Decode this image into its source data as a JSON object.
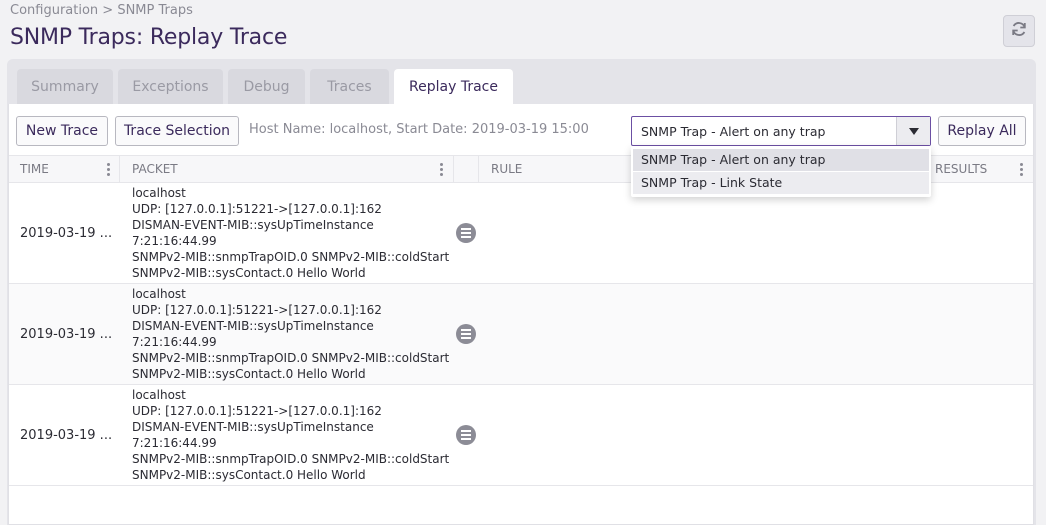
{
  "breadcrumb": "Configuration > SNMP Traps",
  "page_title": "SNMP Traps: Replay Trace",
  "refresh_icon": "refresh-icon",
  "tabs": [
    {
      "label": "Summary",
      "active": false
    },
    {
      "label": "Exceptions",
      "active": false
    },
    {
      "label": "Debug",
      "active": false
    },
    {
      "label": "Traces",
      "active": false
    },
    {
      "label": "Replay Trace",
      "active": true
    }
  ],
  "toolbar": {
    "new_trace": "New Trace",
    "trace_selection": "Trace Selection",
    "host_info": "Host Name: localhost, Start Date: 2019-03-19 15:00",
    "replay_all": "Replay All"
  },
  "rule_select": {
    "value": "SNMP Trap - Alert on any trap",
    "options": [
      "SNMP Trap - Alert on any trap",
      "SNMP Trap - Link State"
    ]
  },
  "columns": {
    "time": "TIME",
    "packet": "PACKET",
    "rule": "RULE",
    "results": "RESULTS"
  },
  "rows": [
    {
      "time": "2019-03-19 ...",
      "packet": [
        "localhost",
        "UDP: [127.0.0.1]:51221->[127.0.0.1]:162",
        "DISMAN-EVENT-MIB::sysUpTimeInstance",
        "7:21:16:44.99",
        "SNMPv2-MIB::snmpTrapOID.0 SNMPv2-MIB::coldStart",
        "SNMPv2-MIB::sysContact.0 Hello World"
      ]
    },
    {
      "time": "2019-03-19 ...",
      "packet": [
        "localhost",
        "UDP: [127.0.0.1]:51221->[127.0.0.1]:162",
        "DISMAN-EVENT-MIB::sysUpTimeInstance",
        "7:21:16:44.99",
        "SNMPv2-MIB::snmpTrapOID.0 SNMPv2-MIB::coldStart",
        "SNMPv2-MIB::sysContact.0 Hello World"
      ]
    },
    {
      "time": "2019-03-19 ...",
      "packet": [
        "localhost",
        "UDP: [127.0.0.1]:51221->[127.0.0.1]:162",
        "DISMAN-EVENT-MIB::sysUpTimeInstance",
        "7:21:16:44.99",
        "SNMPv2-MIB::snmpTrapOID.0 SNMPv2-MIB::coldStart",
        "SNMPv2-MIB::sysContact.0 Hello World"
      ]
    }
  ]
}
